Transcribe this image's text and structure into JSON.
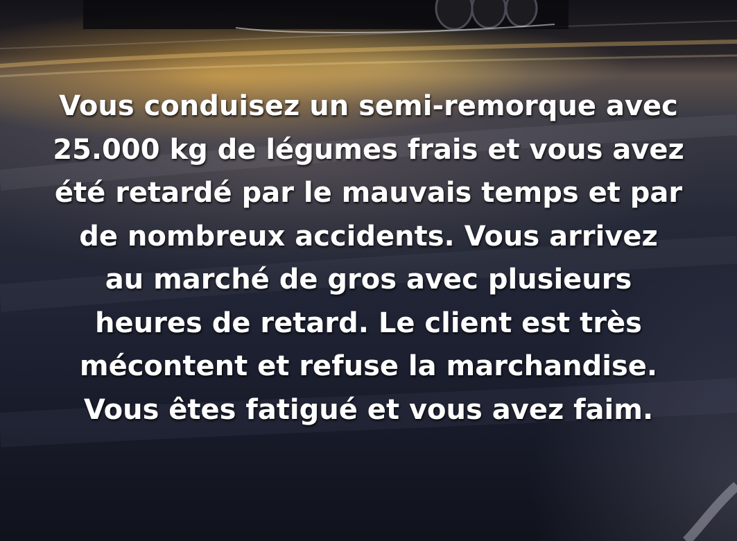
{
  "slide": {
    "background_description_colors": {
      "road_dark": "#1e2233",
      "headlight_glow": "#ffbe46",
      "text": "#ffffff"
    },
    "lines": [
      "Vous conduisez un semi-remorque avec",
      "25.000 kg de légumes frais et vous avez",
      "été retardé par le mauvais temps et par",
      "de nombreux accidents. Vous arrivez",
      "au marché de gros avec plusieurs",
      "heures de retard. Le client est très",
      "mécontent et refuse la marchandise.",
      "Vous êtes fatigué et vous avez faim."
    ]
  }
}
